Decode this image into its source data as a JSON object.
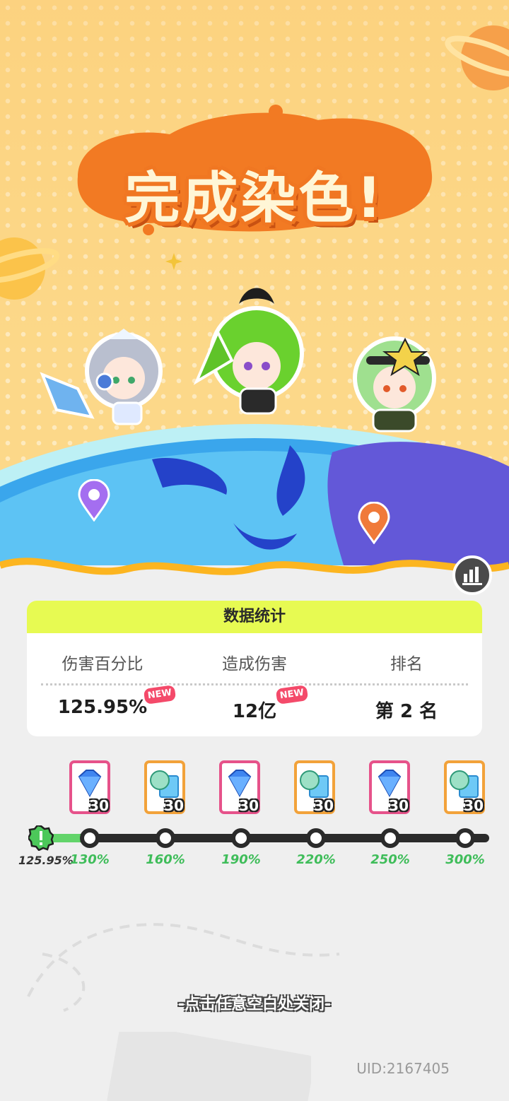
{
  "title": "完成染色!",
  "stats": {
    "header": "数据统计",
    "columns": [
      {
        "label": "伤害百分比",
        "value": "125.95%",
        "badge": "NEW"
      },
      {
        "label": "造成伤害",
        "value": "12亿",
        "badge": "NEW"
      },
      {
        "label": "排名",
        "value": "第 2 名"
      }
    ]
  },
  "rewards": [
    {
      "type": "diamond-icon",
      "qty": "30",
      "frame": "pink"
    },
    {
      "type": "ticket-icon",
      "qty": "30",
      "frame": "orange"
    },
    {
      "type": "diamond-icon",
      "qty": "30",
      "frame": "pink"
    },
    {
      "type": "ticket-icon",
      "qty": "30",
      "frame": "orange"
    },
    {
      "type": "diamond-icon",
      "qty": "30",
      "frame": "pink"
    },
    {
      "type": "ticket-icon",
      "qty": "30",
      "frame": "orange"
    }
  ],
  "progress": {
    "current": "125.95%",
    "milestones": [
      "130%",
      "160%",
      "190%",
      "220%",
      "250%",
      "300%"
    ]
  },
  "close_hint": "-点击任意空白处关闭-",
  "uid": "UID:2167405",
  "colors": {
    "accent": "#e7fa52",
    "progress": "#62d46a",
    "title_outline": "#f07722"
  }
}
